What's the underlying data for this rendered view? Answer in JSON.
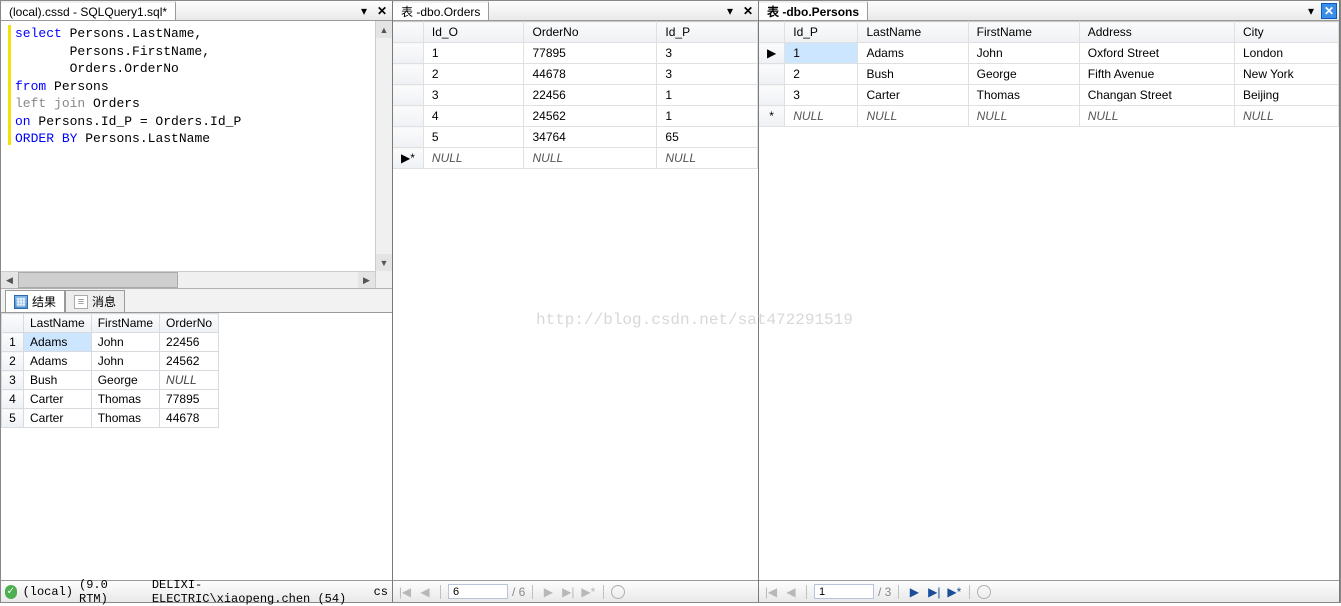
{
  "left": {
    "tabTitle": "(local).cssd - SQLQuery1.sql*",
    "sql_raw": "select Persons.LastName,\n       Persons.FirstName,\n       Orders.OrderNo\nfrom Persons\nleft join Orders\non Persons.Id_P = Orders.Id_P\nORDER BY Persons.LastName",
    "resultsTabs": {
      "results": "结果",
      "messages": "消息"
    },
    "resultCols": [
      "",
      "LastName",
      "FirstName",
      "OrderNo"
    ],
    "resultRows": [
      [
        "1",
        "Adams",
        "John",
        "22456"
      ],
      [
        "2",
        "Adams",
        "John",
        "24562"
      ],
      [
        "3",
        "Bush",
        "George",
        "NULL"
      ],
      [
        "4",
        "Carter",
        "Thomas",
        "77895"
      ],
      [
        "5",
        "Carter",
        "Thomas",
        "44678"
      ]
    ],
    "status": {
      "server": "(local)",
      "version": "(9.0 RTM)",
      "user": "DELIXI-ELECTRIC\\xiaopeng.chen (54)",
      "db": "cs"
    }
  },
  "mid": {
    "tabPrefix": "表 - ",
    "tabTitle": "dbo.Orders",
    "cols": [
      "",
      "Id_O",
      "OrderNo",
      "Id_P"
    ],
    "rows": [
      {
        "mark": "",
        "c": [
          "1",
          "77895",
          "3"
        ]
      },
      {
        "mark": "",
        "c": [
          "2",
          "44678",
          "3"
        ]
      },
      {
        "mark": "",
        "c": [
          "3",
          "22456",
          "1"
        ]
      },
      {
        "mark": "",
        "c": [
          "4",
          "24562",
          "1"
        ]
      },
      {
        "mark": "",
        "c": [
          "5",
          "34764",
          "65"
        ]
      },
      {
        "mark": "▶*",
        "c": [
          "NULL",
          "NULL",
          "NULL"
        ],
        "null": true
      }
    ],
    "nav": {
      "pos": "6",
      "total": "/ 6"
    }
  },
  "right": {
    "tabPrefix": "表 - ",
    "tabTitle": "dbo.Persons",
    "cols": [
      "",
      "Id_P",
      "LastName",
      "FirstName",
      "Address",
      "City"
    ],
    "rows": [
      {
        "mark": "▶",
        "c": [
          "1",
          "Adams",
          "John",
          "Oxford Street",
          "London"
        ],
        "sel": true
      },
      {
        "mark": "",
        "c": [
          "2",
          "Bush",
          "George",
          "Fifth Avenue",
          "New York"
        ]
      },
      {
        "mark": "",
        "c": [
          "3",
          "Carter",
          "Thomas",
          "Changan Street",
          "Beijing"
        ]
      },
      {
        "mark": "*",
        "c": [
          "NULL",
          "NULL",
          "NULL",
          "NULL",
          "NULL"
        ],
        "null": true
      }
    ],
    "nav": {
      "pos": "1",
      "total": "/ 3"
    }
  },
  "watermark": "http://blog.csdn.net/sat472291519"
}
